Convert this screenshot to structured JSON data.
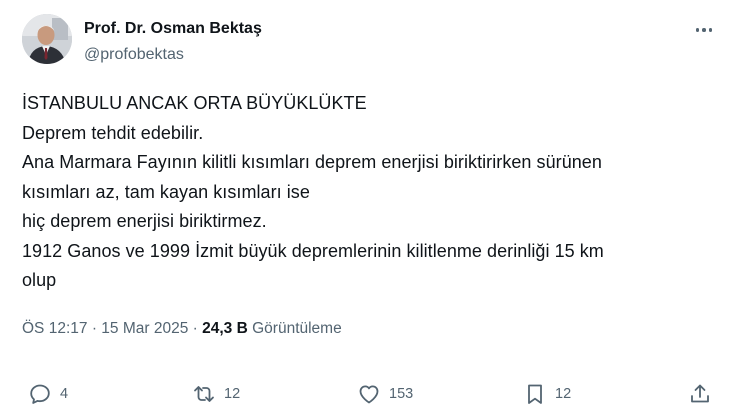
{
  "tweet": {
    "author": {
      "display_name": "Prof. Dr. Osman Bektaş",
      "handle": "@profobektas"
    },
    "text_lines": [
      "İSTANBULU ANCAK ORTA BÜYÜKLÜKTE",
      "Deprem tehdit edebilir.",
      "Ana Marmara Fayının kilitli kısımları deprem enerjisi biriktirirken sürünen",
      "kısımları az, tam kayan kısımları ise",
      "hiç deprem enerjisi biriktirmez.",
      "1912 Ganos ve 1999 İzmit büyük depremlerinin kilitlenme derinliği 15 km",
      "olup"
    ],
    "meta": {
      "time": "ÖS 12:17",
      "separator": "·",
      "date": "15 Mar 2025",
      "views_count": "24,3 B",
      "views_label": "Görüntüleme"
    },
    "actions": {
      "replies": "4",
      "retweets": "12",
      "likes": "153",
      "bookmarks": "12"
    }
  },
  "icons": {
    "more": "more-icon",
    "reply": "reply-icon",
    "retweet": "retweet-icon",
    "like": "heart-icon",
    "bookmark": "bookmark-icon",
    "share": "share-icon"
  },
  "colors": {
    "text": "#0f1419",
    "secondary": "#536471",
    "background": "#ffffff"
  }
}
